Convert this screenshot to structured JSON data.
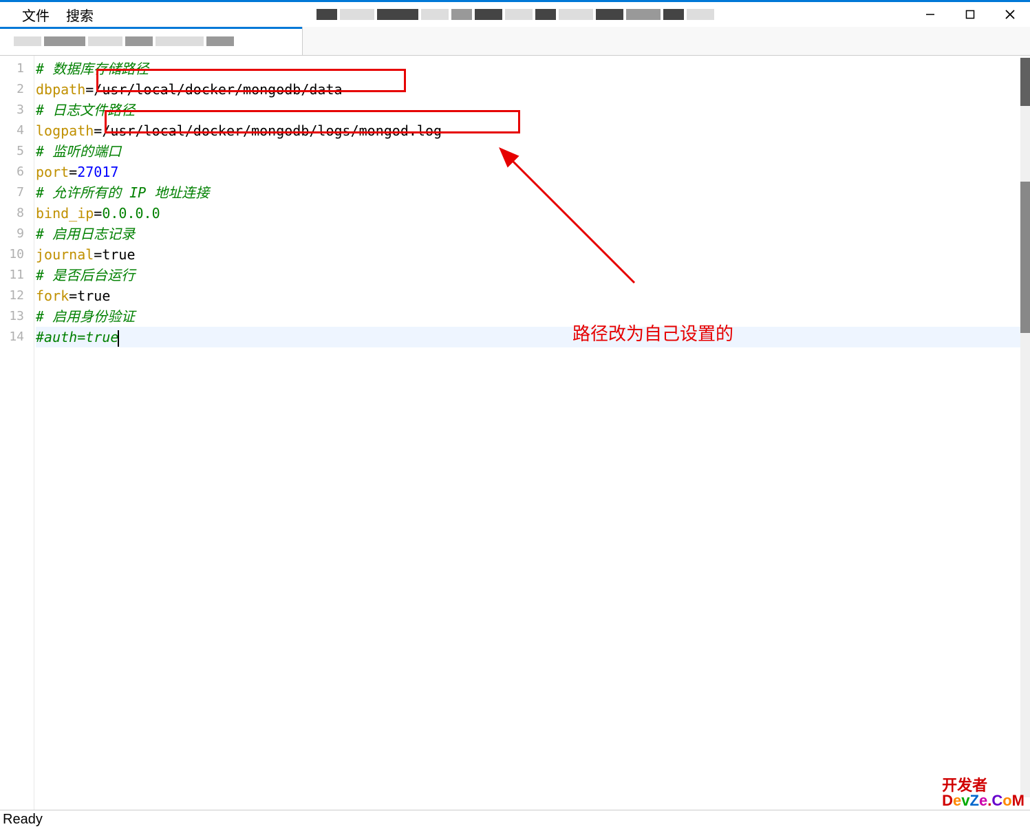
{
  "menu": {
    "file": "文件",
    "search": "搜索"
  },
  "code": {
    "lines": [
      {
        "n": "1",
        "type": "comment",
        "text": "# 数据库存储路径"
      },
      {
        "n": "2",
        "type": "kv",
        "key": "dbpath",
        "eq": "=",
        "val": "/usr/local/docker/mongodb/data"
      },
      {
        "n": "3",
        "type": "comment",
        "text": "# 日志文件路径"
      },
      {
        "n": "4",
        "type": "kv",
        "key": "logpath",
        "eq": "=",
        "val": "/usr/local/docker/mongodb/logs/mongod.log"
      },
      {
        "n": "5",
        "type": "comment",
        "text": "# 监听的端口"
      },
      {
        "n": "6",
        "type": "kvnum",
        "key": "port",
        "eq": "=",
        "val": "27017"
      },
      {
        "n": "7",
        "type": "comment",
        "text": "# 允许所有的 IP 地址连接"
      },
      {
        "n": "8",
        "type": "kvip",
        "key": "bind_ip",
        "eq": "=",
        "val": "0.0.0.0"
      },
      {
        "n": "9",
        "type": "comment",
        "text": "# 启用日志记录"
      },
      {
        "n": "10",
        "type": "kvbool",
        "key": "journal",
        "eq": "=",
        "val": "true"
      },
      {
        "n": "11",
        "type": "comment",
        "text": "# 是否后台运行"
      },
      {
        "n": "12",
        "type": "kvbool",
        "key": "fork",
        "eq": "=",
        "val": "true"
      },
      {
        "n": "13",
        "type": "comment",
        "text": "# 启用身份验证"
      },
      {
        "n": "14",
        "type": "comment-current",
        "text": "#auth=true"
      }
    ]
  },
  "annotation": {
    "text": "路径改为自己设置的"
  },
  "status": {
    "text": "Ready"
  },
  "watermark": {
    "top": "开发者",
    "bot": "DevZe.CoM"
  }
}
